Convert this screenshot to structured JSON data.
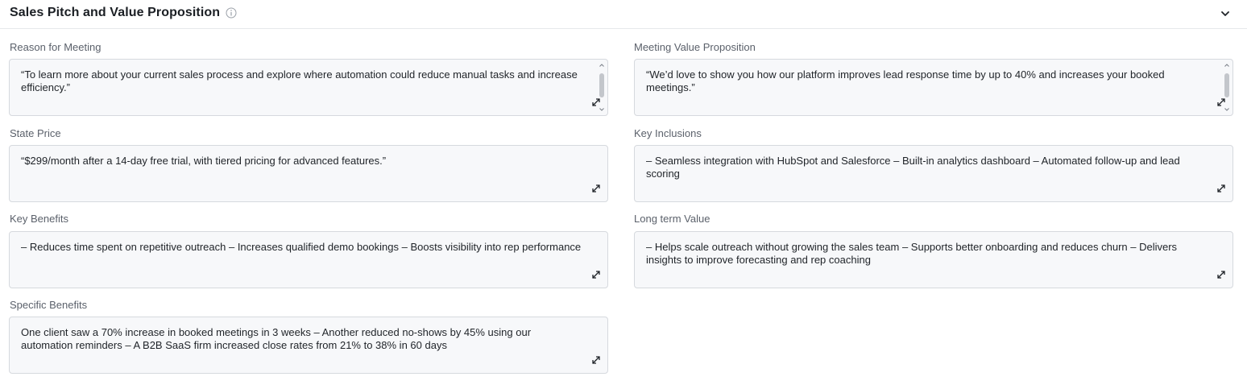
{
  "section": {
    "title": "Sales Pitch and Value Proposition",
    "info_icon": "info-circle-icon",
    "collapse_icon": "chevron-down-icon"
  },
  "fields": {
    "reason_for_meeting": {
      "label": "Reason for Meeting",
      "value": "“To learn more about your current sales process and explore where automation could reduce manual tasks and increase efficiency.”"
    },
    "meeting_value_proposition": {
      "label": "Meeting Value Proposition",
      "value": "“We’d love to show you how our platform improves lead response time by up to 40% and increases your booked meetings.”"
    },
    "state_price": {
      "label": "State Price",
      "value": "“$299/month after a 14-day free trial, with tiered pricing for advanced features.”"
    },
    "key_inclusions": {
      "label": "Key Inclusions",
      "value": "– Seamless integration with HubSpot and Salesforce – Built-in analytics dashboard – Automated follow-up and lead scoring"
    },
    "key_benefits": {
      "label": "Key Benefits",
      "value": "– Reduces time spent on repetitive outreach – Increases qualified demo bookings – Boosts visibility into rep performance"
    },
    "long_term_value": {
      "label": "Long term Value",
      "value": "– Helps scale outreach without growing the sales team – Supports better onboarding and reduces churn – Delivers insights to improve forecasting and rep coaching"
    },
    "specific_benefits": {
      "label": "Specific Benefits",
      "value": "One client saw a 70% increase in booked meetings in 3 weeks – Another reduced no-shows by 45% using our automation reminders – A B2B SaaS firm increased close rates from 21% to 38% in 60 days"
    }
  }
}
